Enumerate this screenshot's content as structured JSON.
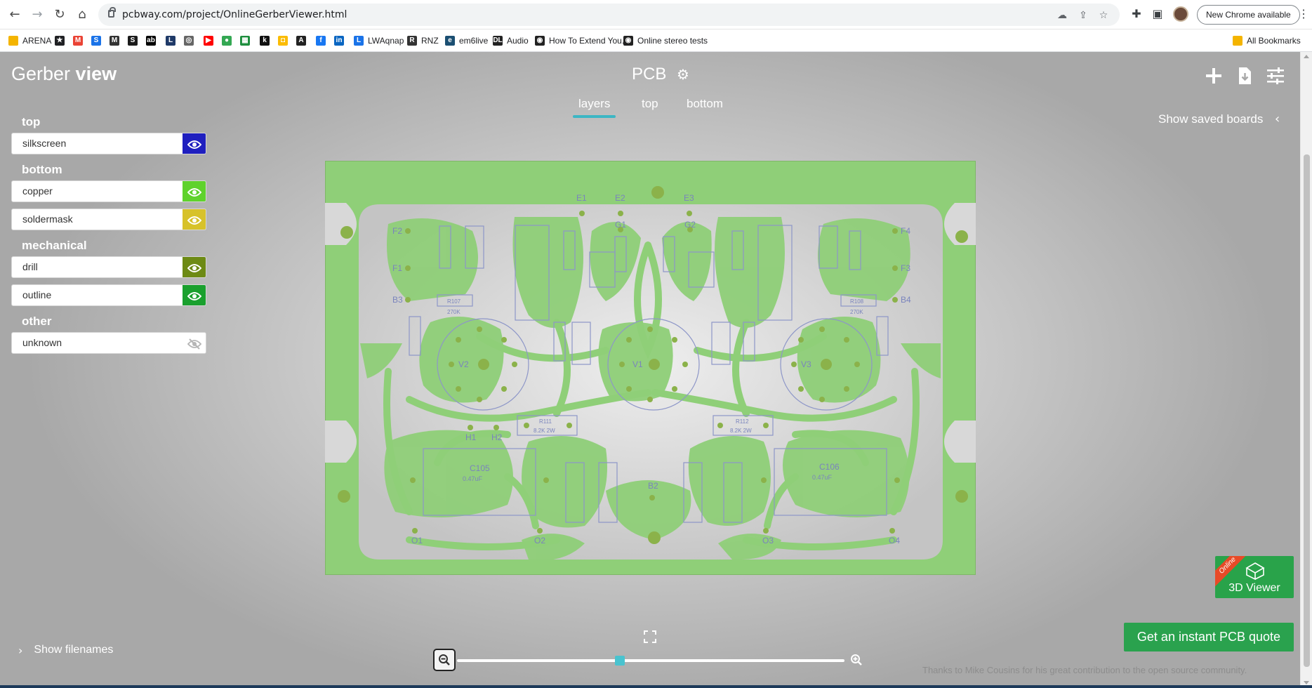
{
  "browser": {
    "url": "pcbway.com/project/OnlineGerberViewer.html",
    "update_label": "New Chrome available",
    "bookmarks": [
      {
        "label": "ARENA",
        "color": "#f4b400",
        "glyph": ""
      },
      {
        "label": "",
        "color": "#202124",
        "glyph": "★"
      },
      {
        "label": "",
        "color": "#ea4335",
        "glyph": "M"
      },
      {
        "label": "",
        "color": "#1a73e8",
        "glyph": "S"
      },
      {
        "label": "",
        "color": "#333333",
        "glyph": "M"
      },
      {
        "label": "",
        "color": "#1b1b1b",
        "glyph": "S"
      },
      {
        "label": "",
        "color": "#000000",
        "glyph": "ab"
      },
      {
        "label": "",
        "color": "#1f3a68",
        "glyph": "L"
      },
      {
        "label": "",
        "color": "#666666",
        "glyph": "◎"
      },
      {
        "label": "",
        "color": "#ff0000",
        "glyph": "▶"
      },
      {
        "label": "",
        "color": "#34a853",
        "glyph": "●"
      },
      {
        "label": "",
        "color": "#1e8e3e",
        "glyph": "▦"
      },
      {
        "label": "",
        "color": "#111111",
        "glyph": "k"
      },
      {
        "label": "",
        "color": "#fbbc04",
        "glyph": "◘"
      },
      {
        "label": "",
        "color": "#222222",
        "glyph": "A"
      },
      {
        "label": "",
        "color": "#1877f2",
        "glyph": "f"
      },
      {
        "label": "",
        "color": "#0a66c2",
        "glyph": "in"
      },
      {
        "label": "LWAqnap",
        "color": "#1a73e8",
        "glyph": "L"
      },
      {
        "label": "RNZ",
        "color": "#333333",
        "glyph": "R"
      },
      {
        "label": "em6live",
        "color": "#1b4f72",
        "glyph": "e"
      },
      {
        "label": "Audio",
        "color": "#222222",
        "glyph": "DL"
      },
      {
        "label": "How To Extend You...",
        "color": "#222222",
        "glyph": "◉"
      },
      {
        "label": "Online stereo tests",
        "color": "#222222",
        "glyph": "◉"
      }
    ],
    "all_bookmarks": "All Bookmarks"
  },
  "app": {
    "title_light": "Gerber ",
    "title_bold": "view",
    "board_name": "PCB",
    "tabs": [
      "layers",
      "top",
      "bottom"
    ],
    "active_tab": "layers",
    "saved_boards": "Show saved boards",
    "show_filenames": "Show filenames",
    "viewer3d_label": "3D Viewer",
    "viewer3d_ribbon": "Online",
    "quote_label": "Get an instant PCB quote",
    "credit": "Thanks to Mike Cousins for his great contribution to the open source community.",
    "zoom_level": 0.42
  },
  "layer_groups": [
    {
      "title": "top",
      "layers": [
        {
          "name": "silkscreen",
          "color": "#1f1fbf",
          "visible": true
        }
      ]
    },
    {
      "title": "bottom",
      "layers": [
        {
          "name": "copper",
          "color": "#5fd22c",
          "visible": true
        },
        {
          "name": "soldermask",
          "color": "#d7c22a",
          "visible": true
        }
      ]
    },
    {
      "title": "mechanical",
      "layers": [
        {
          "name": "drill",
          "color": "#6d8a14",
          "visible": true
        },
        {
          "name": "outline",
          "color": "#1aa02e",
          "visible": true
        }
      ]
    },
    {
      "title": "other",
      "layers": [
        {
          "name": "unknown",
          "color": "#ffffff",
          "visible": false
        }
      ]
    }
  ],
  "pcb_labels": {
    "E1": "E1",
    "E2": "E2",
    "E3": "E3",
    "G1": "G1",
    "G2": "G2",
    "F1": "F1",
    "F2": "F2",
    "F3": "F3",
    "F4": "F4",
    "B2": "B2",
    "B3": "B3",
    "B4": "B4",
    "V1": "V1",
    "V2": "V2",
    "V3": "V3",
    "H1": "H1",
    "H2": "H2",
    "O1": "O1",
    "O2": "O2",
    "O3": "O3",
    "O4": "O4",
    "C105": "C105",
    "C105v": "0.47uF",
    "C106": "C106",
    "C106v": "0.47uF",
    "R107": "R107",
    "R107v": "270K",
    "R108": "R108",
    "R108v": "270K",
    "R111": "R111",
    "R111v": "8.2K 2W",
    "R112": "R112",
    "R112v": "8.2K 2W"
  }
}
